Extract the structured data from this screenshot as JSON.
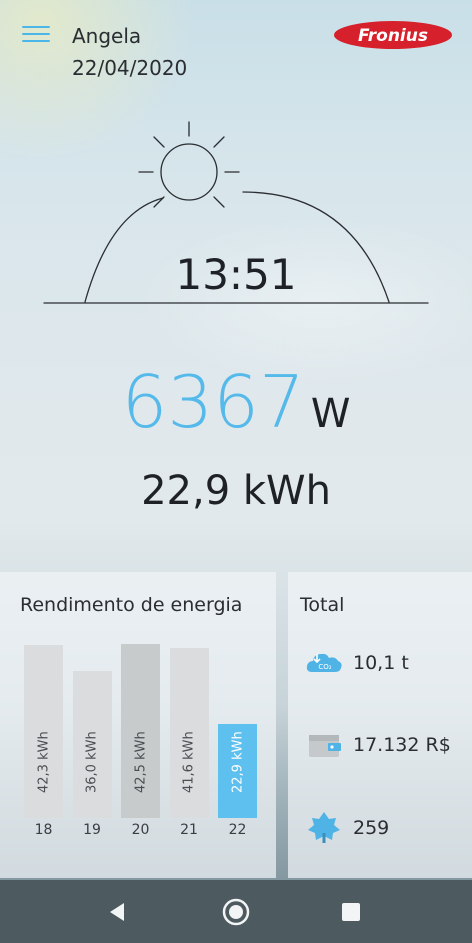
{
  "header": {
    "user_name": "Angela",
    "date": "22/04/2020",
    "logo_text": "Fronius"
  },
  "colors": {
    "accent": "#55b9ea",
    "active_bar": "#5ec0ef",
    "logo_red": "#d6202b"
  },
  "status": {
    "time": "13:51",
    "power_value": "6367",
    "power_unit": "W",
    "energy_today": "22,9 kWh"
  },
  "energy_card": {
    "title": "Rendimento de energia",
    "bars": [
      {
        "day": "18",
        "label": "42,3 kWh",
        "value": 42.3
      },
      {
        "day": "19",
        "label": "36,0 kWh",
        "value": 36.0
      },
      {
        "day": "20",
        "label": "42,5 kWh",
        "value": 42.5
      },
      {
        "day": "21",
        "label": "41,6 kWh",
        "value": 41.6
      },
      {
        "day": "22",
        "label": "22,9 kWh",
        "value": 22.9
      }
    ]
  },
  "total_card": {
    "title": "Total",
    "items": [
      {
        "icon": "co2-cloud-icon",
        "value": "10,1 t"
      },
      {
        "icon": "wallet-icon",
        "value": "17.132 R$"
      },
      {
        "icon": "tree-icon",
        "value": "259"
      }
    ]
  },
  "navbar": {
    "icons": [
      "back-icon",
      "home-icon",
      "recent-apps-icon"
    ]
  }
}
